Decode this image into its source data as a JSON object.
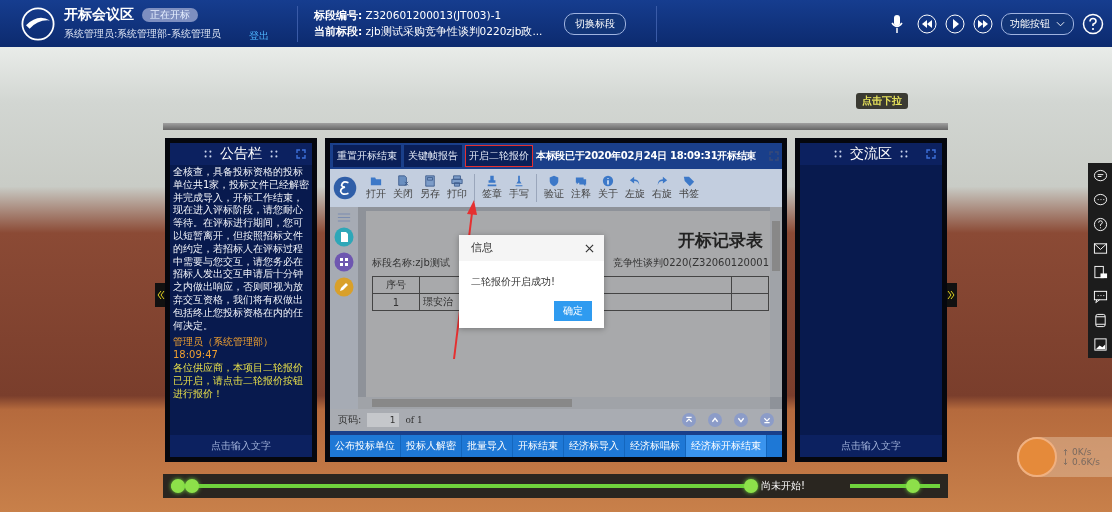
{
  "topbar": {
    "title": "开标会议区",
    "badge": "正在开标",
    "user": "系统管理员:系统管理部-系统管理员",
    "logout": "登出",
    "section_no_label": "标段编号:",
    "section_no": "Z320601200013(JT003)-1",
    "current_label": "当前标段:",
    "current": "zjb测试采购竞争性谈判0220zjb政...",
    "switch_button": "切换标段",
    "function_button": "功能按钮"
  },
  "tooltip": "点击下拉",
  "notice_panel": {
    "title": "公告栏",
    "text": "全核查，具备投标资格的投标单位共1家，投标文件已经解密并完成导入，开标工作结束，现在进入评标阶段，请您耐心等待。在评标进行期间，您可以短暂离开，但按照招标文件的约定，若招标人在评标过程中需要与您交互，请您务必在招标人发出交互申请后十分钟之内做出响应，否则即视为放弃交互资格，我们将有权做出包括终止您投标资格在内的任何决定。",
    "message_header": "管理员（系统管理部）18:09:47",
    "message": "各位供应商，本项目二轮报价已开启，请点击二轮报价按钮进行报价！",
    "input_placeholder": "点击输入文字"
  },
  "center": {
    "buttons": [
      {
        "label": "重置开标结束",
        "highlighted": false
      },
      {
        "label": "关键帧报告",
        "highlighted": false
      },
      {
        "label": "开启二轮报价",
        "highlighted": true
      }
    ],
    "status": "本标段已于2020年02月24日 18:09:31开标结束",
    "tools": [
      {
        "label": "打开"
      },
      {
        "label": "关闭"
      },
      {
        "label": "另存"
      },
      {
        "label": "打印"
      },
      {
        "label": "签章"
      },
      {
        "label": "手写"
      },
      {
        "label": "验证"
      },
      {
        "label": "注释"
      },
      {
        "label": "关于"
      },
      {
        "label": "左旋"
      },
      {
        "label": "右旋"
      },
      {
        "label": "书签"
      }
    ],
    "document": {
      "title": "开标记录表",
      "name_left": "标段名称:zjb测试",
      "name_right": "竞争性谈判0220(Z32060120001",
      "table": [
        [
          "序号"
        ],
        [
          "1",
          "璟安治"
        ]
      ]
    },
    "dialog": {
      "title": "信息",
      "message": "二轮报价开启成功!",
      "ok": "确定"
    },
    "pager": {
      "label": "页码:",
      "page": "1",
      "of": "of 1"
    },
    "tabs": [
      {
        "label": "公布投标单位",
        "selected": false
      },
      {
        "label": "投标人解密",
        "selected": false
      },
      {
        "label": "批量导入",
        "selected": false
      },
      {
        "label": "开标结束",
        "selected": false
      },
      {
        "label": "经济标导入",
        "selected": false
      },
      {
        "label": "经济标唱标",
        "selected": false
      },
      {
        "label": "经济标开标结束",
        "selected": true
      }
    ]
  },
  "chat_panel": {
    "title": "交流区",
    "input_placeholder": "点击输入文字"
  },
  "timeline": {
    "level": 1,
    "status": "尚未开始!"
  },
  "volume": {
    "level": 0.7
  },
  "speed": {
    "up": "0K/s",
    "down": "0.6K/s"
  }
}
